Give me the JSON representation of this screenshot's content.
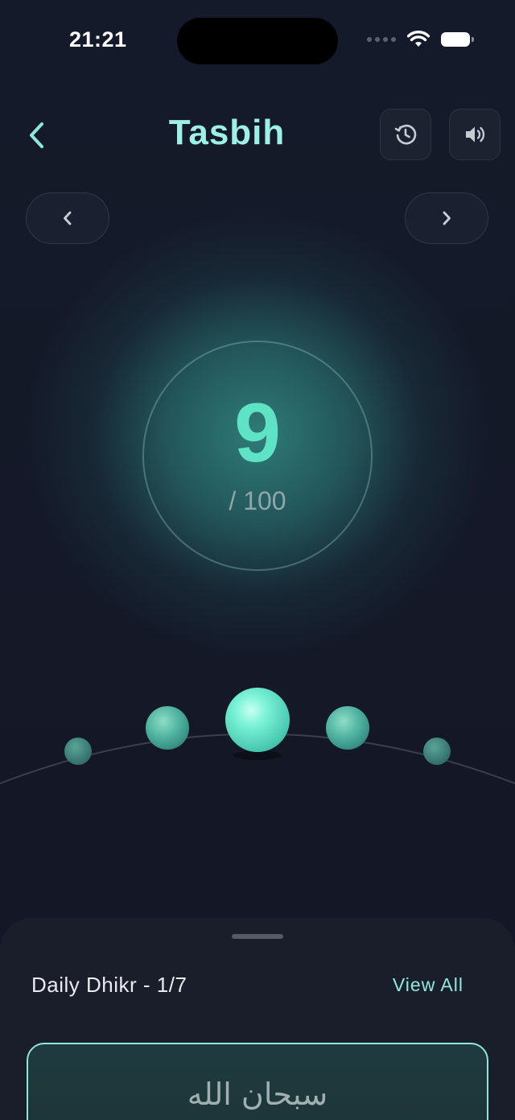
{
  "status_bar": {
    "time": "21:21"
  },
  "header": {
    "title": "Tasbih",
    "back_icon": "chevron-left-icon",
    "history_icon": "history-icon",
    "sound_icon": "speaker-icon"
  },
  "navigation": {
    "prev_icon": "chevron-left-icon",
    "next_icon": "chevron-right-icon"
  },
  "counter": {
    "count": "9",
    "target": "/ 100"
  },
  "bottom_sheet": {
    "title": "Daily Dhikr - 1/7",
    "view_all_label": "View All",
    "dhikr_arabic": "سبحان الله"
  },
  "colors": {
    "accent": "#9ef0e6",
    "count": "#5fe3c5",
    "background": "#141826"
  }
}
